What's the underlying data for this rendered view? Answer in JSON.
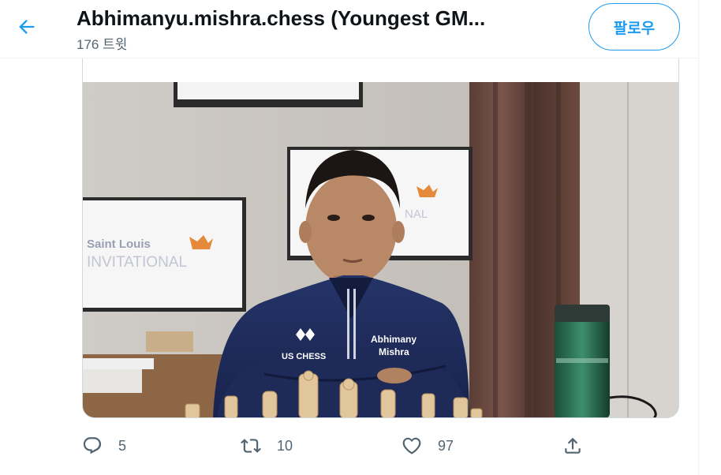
{
  "header": {
    "title": "Abhimanyu.mishra.chess (Youngest GM...",
    "tweet_count": "176 트윗",
    "follow_label": "팔로우"
  },
  "photo": {
    "tv_left_text": "Saint Louis",
    "tv_left_subtext": "INVITATIONAL",
    "tv_center_text": "NAL",
    "jacket_logo_text": "US CHESS",
    "jacket_name_line1": "Abhimany",
    "jacket_name_line2": "Mishra"
  },
  "actions": {
    "reply_count": "5",
    "retweet_count": "10",
    "like_count": "97"
  },
  "colors": {
    "accent": "#1d9bf0",
    "text_secondary": "#536471",
    "jacket": "#1d2b5c"
  },
  "icons": [
    "back-arrow-icon",
    "reply-icon",
    "retweet-icon",
    "like-icon",
    "share-icon"
  ]
}
